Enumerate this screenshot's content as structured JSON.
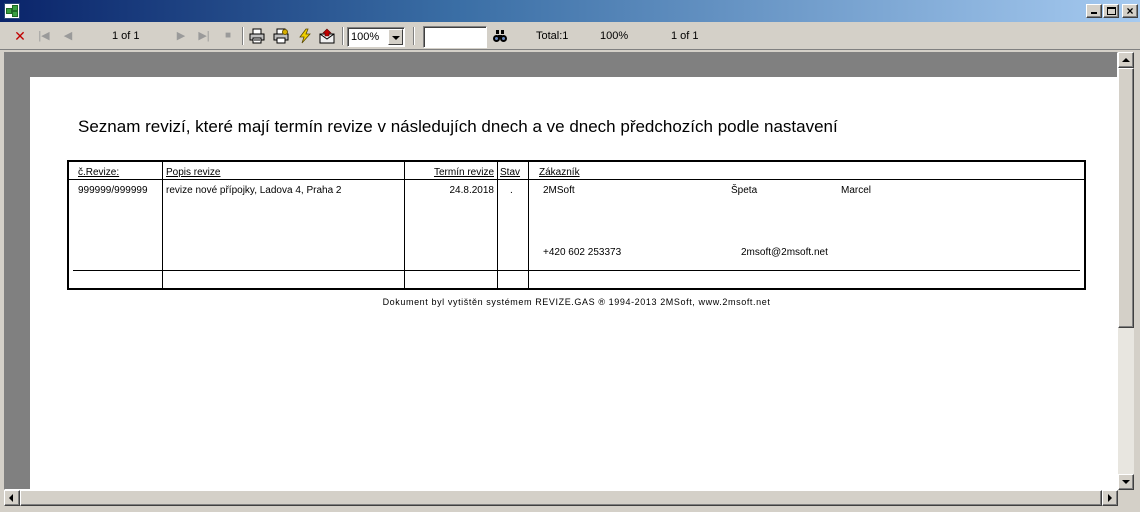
{
  "toolbar": {
    "page_indicator": "1 of 1",
    "zoom_value": "100%",
    "search_value": "",
    "status_total": "Total:1",
    "status_zoom": "100%",
    "status_pages": "1 of 1"
  },
  "report": {
    "title": "Seznam revizí, které mají termín revize v následujích dnech a ve dnech předchozích podle nastavení",
    "headers": {
      "cislo": "č.Revize:",
      "popis": "Popis revize",
      "termin": "Termín revize",
      "stav": "Stav",
      "zakaznik": "Zákazník"
    },
    "rows": [
      {
        "cislo": "999999/999999",
        "popis": "revize nové přípojky, Ladova 4, Praha 2",
        "termin": "24.8.2018",
        "stav": ".",
        "firma": "2MSoft",
        "prijmeni": "Špeta",
        "jmeno": "Marcel",
        "telefon": "+420 602 253373",
        "email": "2msoft@2msoft.net"
      }
    ],
    "footer": "Dokument byl vytištěn  systémem  REVIZE.GAS  ® 1994-2013  2MSoft, www.2msoft.net"
  },
  "colors": {
    "title_bar_start": "#0a246a",
    "title_bar_end": "#a6caf0",
    "close_icon": "#c00000",
    "window_face": "#d4d0c8"
  }
}
